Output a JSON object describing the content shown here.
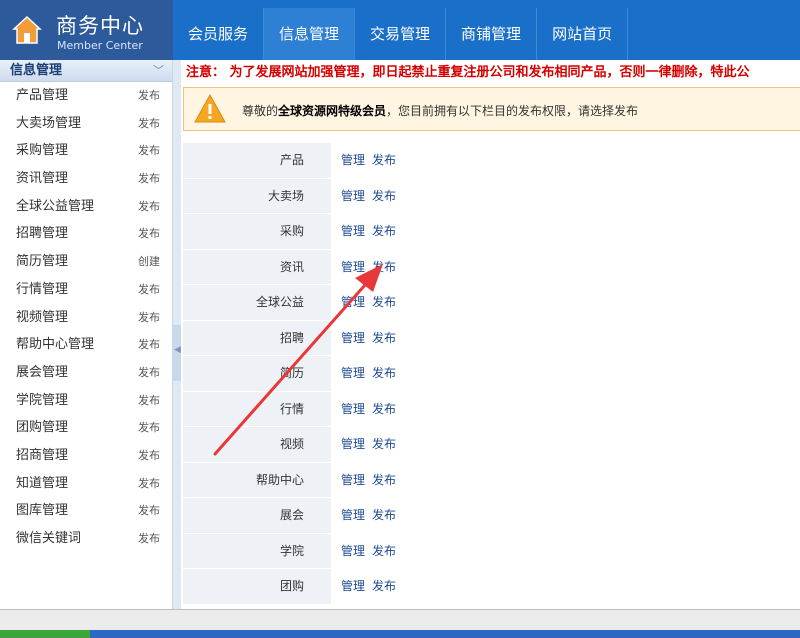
{
  "header": {
    "title": "商务中心",
    "subtitle": "Member Center",
    "nav": [
      "会员服务",
      "信息管理",
      "交易管理",
      "商铺管理",
      "网站首页"
    ],
    "active_index": 1
  },
  "sidebar": {
    "heading": "信息管理",
    "items": [
      {
        "label": "产品管理",
        "action": "发布"
      },
      {
        "label": "大卖场管理",
        "action": "发布"
      },
      {
        "label": "采购管理",
        "action": "发布"
      },
      {
        "label": "资讯管理",
        "action": "发布"
      },
      {
        "label": "全球公益管理",
        "action": "发布"
      },
      {
        "label": "招聘管理",
        "action": "发布"
      },
      {
        "label": "简历管理",
        "action": "创建"
      },
      {
        "label": "行情管理",
        "action": "发布"
      },
      {
        "label": "视频管理",
        "action": "发布"
      },
      {
        "label": "帮助中心管理",
        "action": "发布"
      },
      {
        "label": "展会管理",
        "action": "发布"
      },
      {
        "label": "学院管理",
        "action": "发布"
      },
      {
        "label": "团购管理",
        "action": "发布"
      },
      {
        "label": "招商管理",
        "action": "发布"
      },
      {
        "label": "知道管理",
        "action": "发布"
      },
      {
        "label": "图库管理",
        "action": "发布"
      },
      {
        "label": "微信关键词",
        "action": "发布"
      }
    ]
  },
  "main": {
    "notice": "注意： 为了发展网站加强管理，即日起禁止重复注册公司和发布相同产品，否则一律删除，特此公",
    "alert_prefix": "尊敬的",
    "alert_strong": "全球资源网特级会员",
    "alert_suffix": "，您目前拥有以下栏目的发布权限，请选择发布",
    "manage_label": "管理",
    "publish_label": "发布",
    "rows": [
      "产品",
      "大卖场",
      "采购",
      "资讯",
      "全球公益",
      "招聘",
      "简历",
      "行情",
      "视频",
      "帮助中心",
      "展会",
      "学院",
      "团购"
    ]
  },
  "colors": {
    "header": "#1a6fc9",
    "notice": "#d40000",
    "arrow": "#e8393a"
  }
}
